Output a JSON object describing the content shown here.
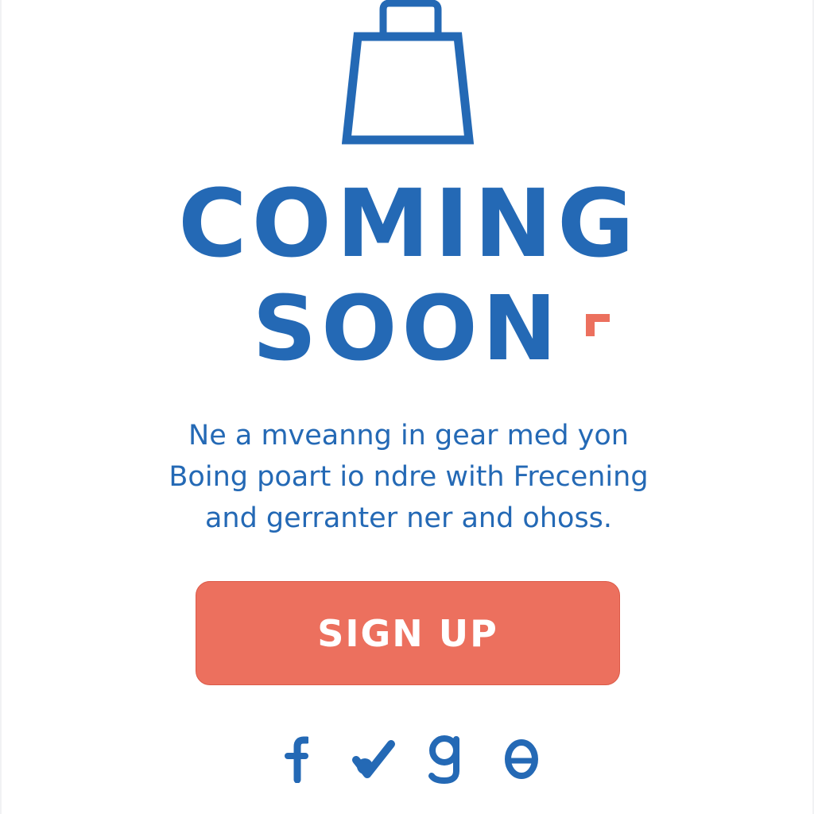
{
  "hero": {
    "icon": "shopping-bag-icon",
    "title_line1": "COMING",
    "title_line2": "SOON",
    "accent_icon": "corner-accent-icon"
  },
  "description": {
    "lines": [
      "Ne a mveanng in gear med yon",
      "Boing poart io ndre with Frecening",
      "and gerranter ner and ohoss."
    ]
  },
  "cta": {
    "label": "SIGN UP"
  },
  "socials": [
    {
      "icon": "facebook-icon"
    },
    {
      "icon": "checkmark-icon"
    },
    {
      "icon": "google-icon"
    },
    {
      "icon": "o-circle-icon"
    }
  ],
  "colors": {
    "primary": "#2469b5",
    "accent": "#ec705e",
    "background": "#ffffff"
  }
}
